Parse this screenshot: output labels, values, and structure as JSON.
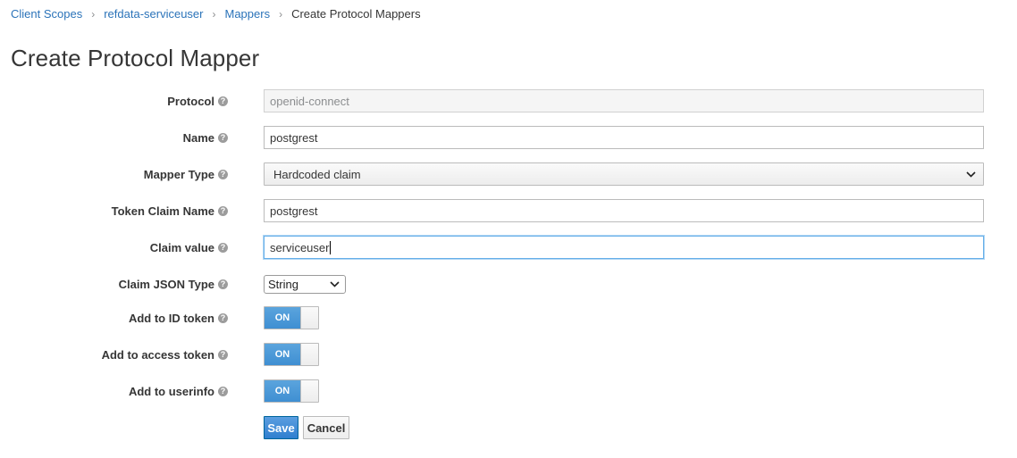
{
  "breadcrumb": {
    "items": [
      "Client Scopes",
      "refdata-serviceuser",
      "Mappers"
    ],
    "current": "Create Protocol Mappers"
  },
  "page": {
    "title": "Create Protocol Mapper"
  },
  "form": {
    "protocol": {
      "label": "Protocol",
      "value": "openid-connect"
    },
    "name": {
      "label": "Name",
      "value": "postgrest"
    },
    "mapper_type": {
      "label": "Mapper Type",
      "value": "Hardcoded claim"
    },
    "token_claim_name": {
      "label": "Token Claim Name",
      "value": "postgrest"
    },
    "claim_value": {
      "label": "Claim value",
      "value": "serviceuser"
    },
    "claim_json_type": {
      "label": "Claim JSON Type",
      "value": "String"
    },
    "add_to_id_token": {
      "label": "Add to ID token",
      "state": "ON"
    },
    "add_to_access_token": {
      "label": "Add to access token",
      "state": "ON"
    },
    "add_to_userinfo": {
      "label": "Add to userinfo",
      "state": "ON"
    }
  },
  "actions": {
    "save": "Save",
    "cancel": "Cancel"
  },
  "icons": {
    "help": "question-circle-icon",
    "separator": "chevron-right-icon",
    "dropdown": "chevron-down-icon"
  },
  "colors": {
    "link": "#2b73b9",
    "primary": "#2f7fcf",
    "toggle_on": "#3f8fd2"
  }
}
